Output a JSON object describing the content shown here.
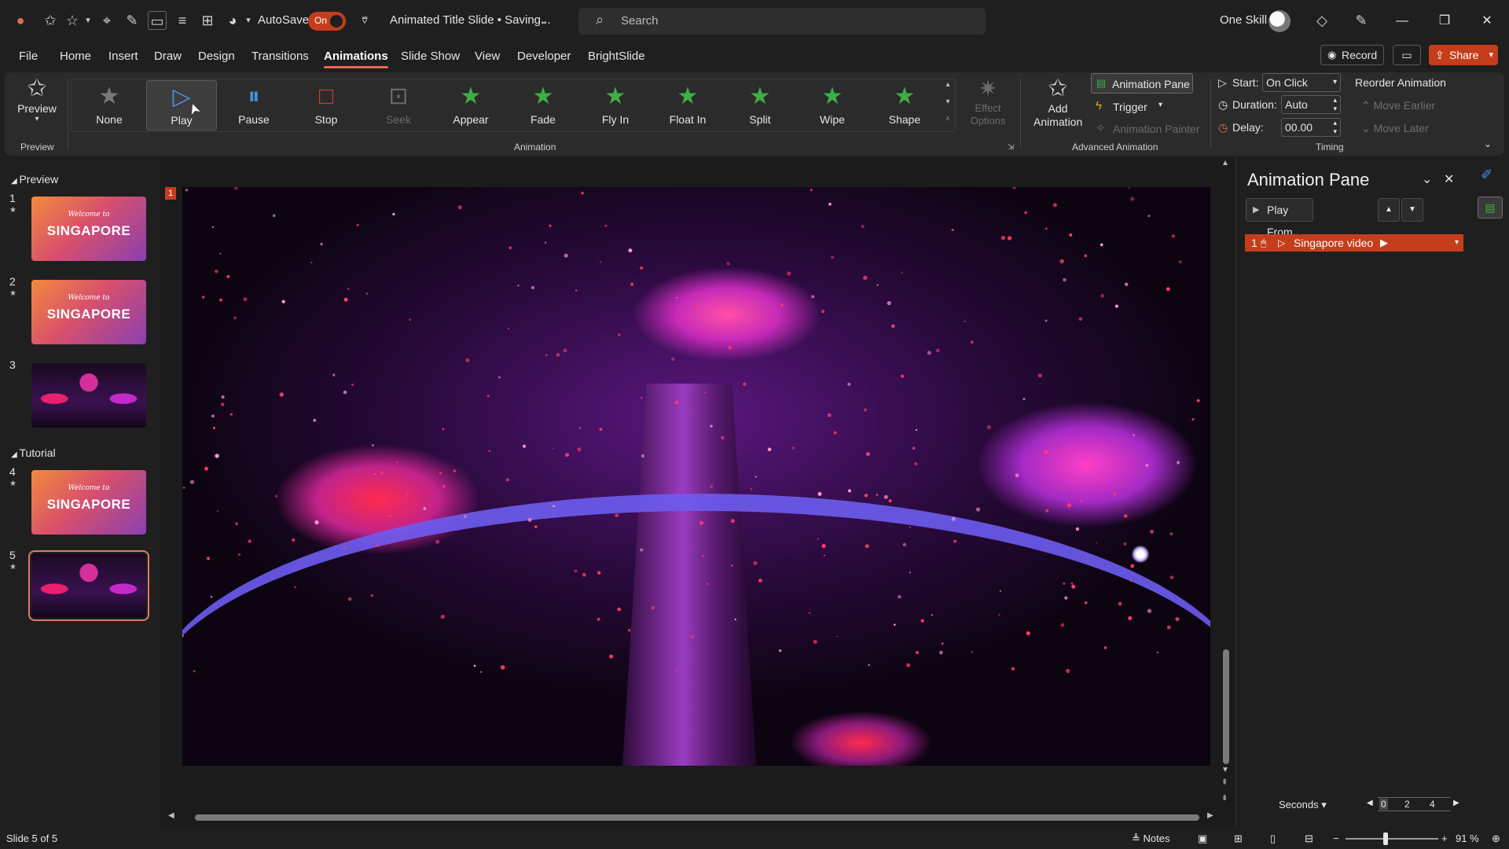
{
  "titlebar": {
    "autosave_label": "AutoSave",
    "autosave_state": "On",
    "document_title": "Animated Title Slide • Saving...",
    "search_placeholder": "Search",
    "user_name": "One Skill"
  },
  "menu": {
    "tabs": [
      "File",
      "Home",
      "Insert",
      "Draw",
      "Design",
      "Transitions",
      "Animations",
      "Slide Show",
      "View",
      "Developer",
      "BrightSlide"
    ],
    "active_tab": "Animations",
    "record_label": "Record",
    "share_label": "Share"
  },
  "ribbon": {
    "preview_label": "Preview",
    "preview_group": "Preview",
    "animations": [
      {
        "name": "None",
        "icon": "star-outline-icon",
        "color": "#7a7a7a",
        "state": "normal"
      },
      {
        "name": "Play",
        "icon": "play-triangle-icon",
        "color": "#4a90e2",
        "state": "selected"
      },
      {
        "name": "Pause",
        "icon": "pause-icon",
        "color": "#4a90e2",
        "state": "normal"
      },
      {
        "name": "Stop",
        "icon": "stop-square-icon",
        "color": "#d83b3b",
        "state": "normal"
      },
      {
        "name": "Seek",
        "icon": "seek-icon",
        "color": "#6a6a6a",
        "state": "disabled"
      },
      {
        "name": "Appear",
        "icon": "star-green-icon",
        "color": "#3cb043",
        "state": "normal"
      },
      {
        "name": "Fade",
        "icon": "star-green-icon",
        "color": "#3cb043",
        "state": "normal"
      },
      {
        "name": "Fly In",
        "icon": "star-green-icon",
        "color": "#3cb043",
        "state": "normal"
      },
      {
        "name": "Float In",
        "icon": "star-green-icon",
        "color": "#3cb043",
        "state": "normal"
      },
      {
        "name": "Split",
        "icon": "star-green-icon",
        "color": "#3cb043",
        "state": "normal"
      },
      {
        "name": "Wipe",
        "icon": "star-green-icon",
        "color": "#3cb043",
        "state": "normal"
      },
      {
        "name": "Shape",
        "icon": "star-green-icon",
        "color": "#3cb043",
        "state": "normal"
      }
    ],
    "effect_options": "Effect Options",
    "animation_group": "Animation",
    "add_animation": "Add Animation",
    "animation_pane_btn": "Animation Pane",
    "trigger": "Trigger",
    "animation_painter": "Animation Painter",
    "advanced_group": "Advanced Animation",
    "start_label": "Start:",
    "start_value": "On Click",
    "duration_label": "Duration:",
    "duration_value": "Auto",
    "delay_label": "Delay:",
    "delay_value": "00.00",
    "timing_group": "Timing",
    "reorder_label": "Reorder Animation",
    "move_earlier": "Move Earlier",
    "move_later": "Move Later"
  },
  "thumbnails": {
    "sections": [
      "Preview",
      "Tutorial"
    ],
    "slides": [
      {
        "number": "1",
        "kind": "title",
        "welcome": "Welcome to",
        "text": "SINGAPORE"
      },
      {
        "number": "2",
        "kind": "title",
        "welcome": "Welcome to",
        "text": "SINGAPORE"
      },
      {
        "number": "3",
        "kind": "photo"
      },
      {
        "number": "4",
        "kind": "title",
        "welcome": "Welcome to",
        "text": "SINGAPORE"
      },
      {
        "number": "5",
        "kind": "photo"
      }
    ]
  },
  "slide": {
    "marker": "1"
  },
  "animation_pane": {
    "title": "Animation Pane",
    "play_from": "Play From",
    "items": [
      {
        "index": "1",
        "name": "Singapore video"
      }
    ],
    "seconds_label": "Seconds",
    "timeline_ticks": [
      "0",
      "2",
      "4"
    ]
  },
  "status": {
    "slide_indicator": "Slide 5 of 5",
    "notes_label": "Notes",
    "zoom": "91 %"
  }
}
